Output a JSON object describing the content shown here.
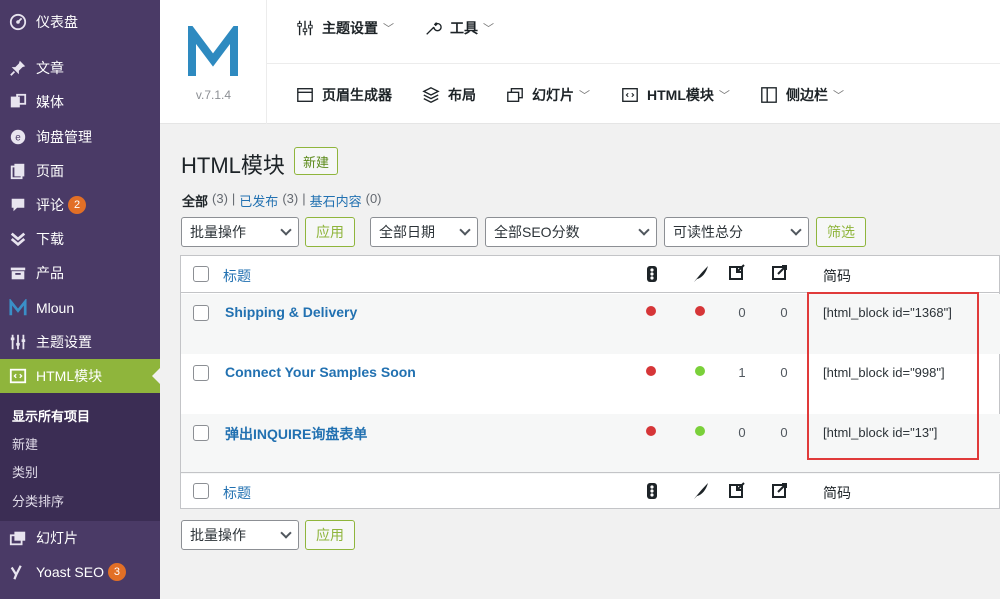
{
  "sidebar": {
    "items": [
      {
        "label": "仪表盘",
        "icon": "dashboard-icon"
      },
      {
        "label": "文章",
        "icon": "pushpin-icon"
      },
      {
        "label": "媒体",
        "icon": "media-icon"
      },
      {
        "label": "询盘管理",
        "icon": "inquiry-icon"
      },
      {
        "label": "页面",
        "icon": "page-icon"
      },
      {
        "label": "评论",
        "icon": "comment-icon",
        "badge": "2"
      },
      {
        "label": "下载",
        "icon": "download-icon"
      },
      {
        "label": "产品",
        "icon": "product-icon"
      },
      {
        "label": "Mloun",
        "icon": "m-logo-icon"
      },
      {
        "label": "主题设置",
        "icon": "sliders-icon"
      },
      {
        "label": "HTML模块",
        "icon": "code-icon"
      },
      {
        "label": "幻灯片",
        "icon": "slides-icon"
      },
      {
        "label": "Yoast SEO",
        "icon": "yoast-icon",
        "badge": "3"
      }
    ],
    "submenu": [
      "显示所有项目",
      "新建",
      "类别",
      "分类排序"
    ]
  },
  "header": {
    "version": "v.7.1.4",
    "row1": [
      "主题设置",
      "工具"
    ],
    "row2": [
      "页眉生成器",
      "布局",
      "幻灯片",
      "HTML模块",
      "侧边栏"
    ]
  },
  "page": {
    "title": "HTML模块",
    "new_button": "新建",
    "filters": {
      "all_label": "全部",
      "all_count": "(3)",
      "published_label": "已发布",
      "published_count": "(3)",
      "cornerstone_label": "基石内容",
      "cornerstone_count": "(0)",
      "sep": "|"
    },
    "bulk_action": "批量操作",
    "apply": "应用",
    "date_filter": "全部日期",
    "seo_filter": "全部SEO分数",
    "readability_filter": "可读性总分",
    "filter_button": "筛选"
  },
  "table": {
    "col_title": "标题",
    "col_code": "简码",
    "rows": [
      {
        "title": "Shipping & Delivery",
        "seo": "#d63638",
        "readability": "#d63638",
        "links_in": "0",
        "links_out": "0",
        "code": "[html_block id=\"1368\"]"
      },
      {
        "title": "Connect Your Samples Soon",
        "seo": "#d63638",
        "readability": "#7ad03a",
        "links_in": "1",
        "links_out": "0",
        "code": "[html_block id=\"998\"]"
      },
      {
        "title": "弹出INQUIRE询盘表单",
        "seo": "#d63638",
        "readability": "#7ad03a",
        "links_in": "0",
        "links_out": "0",
        "code": "[html_block id=\"13\"]"
      }
    ]
  },
  "colors": {
    "sidebar_bg": "#4a3a66",
    "accent": "#8fb53c",
    "link": "#2271b1",
    "highlight": "#e03a3a"
  }
}
